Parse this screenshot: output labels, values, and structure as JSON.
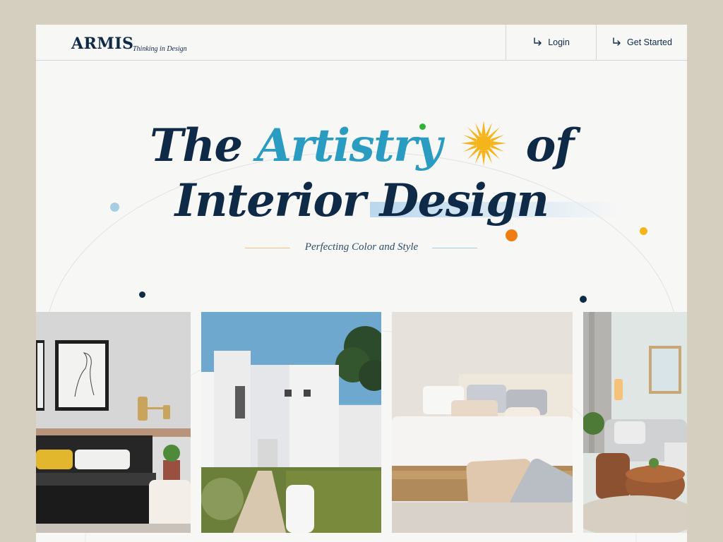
{
  "brand": {
    "logo": "ARMIS",
    "tagline": "Thinking in Design"
  },
  "nav": {
    "login_label": "Login",
    "get_started_label": "Get Started",
    "icon": "arrow-down-right-icon"
  },
  "hero": {
    "title_word1": "The",
    "title_accent": "Artistry",
    "title_word2": "of",
    "title_line2": "Interior Design",
    "subtitle": "Perfecting Color and Style",
    "icon": "sun-icon"
  },
  "colors": {
    "background": "#d4cfbf",
    "navy": "#0e2a47",
    "accent_blue": "#2b9cc1",
    "sun_yellow": "#f4b41a",
    "orange": "#f07d12",
    "green": "#2eb336",
    "light_blue": "#a6cde1"
  },
  "gallery": [
    {
      "name": "bedroom-dark-photo"
    },
    {
      "name": "white-house-photo"
    },
    {
      "name": "bedroom-neutral-photo"
    },
    {
      "name": "living-room-photo"
    }
  ]
}
